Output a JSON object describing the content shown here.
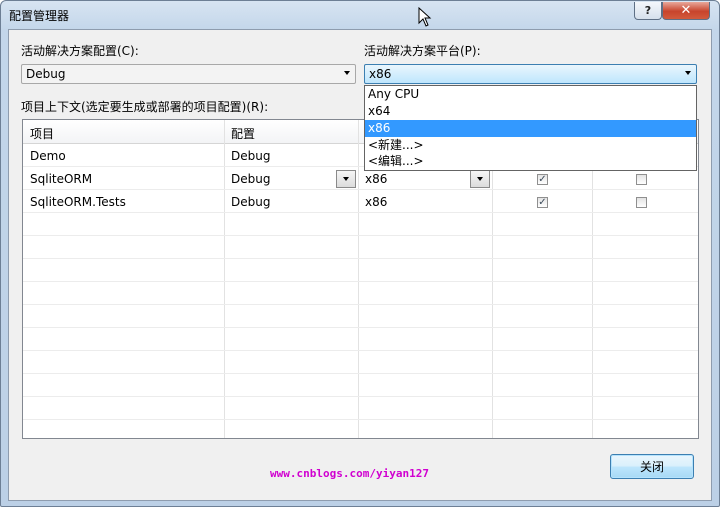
{
  "window": {
    "title": "配置管理器",
    "help_label": "?",
    "close_label": "✕"
  },
  "solution_config": {
    "label": "活动解决方案配置(C):",
    "value": "Debug"
  },
  "solution_platform": {
    "label": "活动解决方案平台(P):",
    "value": "x86",
    "options": [
      "Any CPU",
      "x64",
      "x86",
      "<新建...>",
      "<编辑...>"
    ],
    "selected_index": 2
  },
  "project_contexts": {
    "label": "项目上下文(选定要生成或部署的项目配置)(R):",
    "headers": [
      "项目",
      "配置"
    ],
    "rows": [
      {
        "project": "Demo",
        "config": "Debug",
        "platform": "",
        "build": false,
        "deploy": false
      },
      {
        "project": "SqliteORM",
        "config": "Debug",
        "platform": "x86",
        "build": true,
        "deploy": false
      },
      {
        "project": "SqliteORM.Tests",
        "config": "Debug",
        "platform": "x86",
        "build": true,
        "deploy": false
      }
    ]
  },
  "watermark": "www.cnblogs.com/yiyan127",
  "footer": {
    "close_label": "关闭"
  },
  "colors": {
    "selection": "#3399ff",
    "watermark": "#d000d0"
  }
}
